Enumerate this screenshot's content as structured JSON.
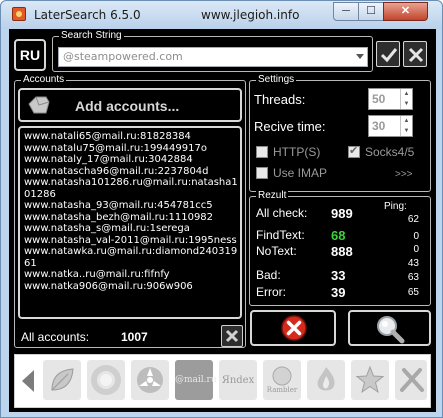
{
  "window": {
    "title": "LaterSearch 6.5.0",
    "site": "www.jlegioh.info",
    "min_label": "─",
    "max_label": "☐",
    "close_label": "✕"
  },
  "search": {
    "lang_label": "RU",
    "group_label": "Search String",
    "value": "@steampowered.com"
  },
  "accounts": {
    "group_label": "Accounts",
    "add_label": "Add accounts...",
    "lines": [
      "www.natali65@mail.ru:81828384",
      "www.natalu75@mail.ru:199449917o",
      "www.nataly_17@mail.ru:3042884",
      "www.natascha96@mail.ru:2237804d",
      "www.natasha101286.ru@mail.ru:natasha1",
      "01286",
      "www.natasha_93@mail.ru:454781cc5",
      "www.natasha_bezh@mail.ru:1110982",
      "www.natasha_s@mail.ru:1serega",
      "www.natasha_val-2011@mail.ru:1995ness",
      "www.natawka.ru@mail.ru:diamond240319",
      "61",
      "www.natka..ru@mail.ru:fifnfy",
      "www.natka906@mail.ru:906w906"
    ],
    "all_label": "All accounts:",
    "all_count": "1007"
  },
  "settings": {
    "group_label": "Settings",
    "threads_label": "Threads:",
    "threads_value": "50",
    "recive_label": "Recive time:",
    "recive_value": "30",
    "https_label": "HTTP(S)",
    "https_checked": false,
    "socks_label": "Socks4/5",
    "socks_checked": true,
    "imap_label": "Use IMAP",
    "imap_checked": false,
    "more_label": ">>>"
  },
  "rezult": {
    "group_label": "Rezult",
    "all_check_label": "All check:",
    "all_check_value": "989",
    "find_label": "FindText:",
    "find_value": "68",
    "notext_label": "NoText:",
    "notext_value": "888",
    "bad_label": "Bad:",
    "bad_value": "33",
    "error_label": "Error:",
    "error_value": "39",
    "ping_label": "Ping:",
    "pings": [
      "62",
      "0",
      "0",
      "43",
      "63",
      "65"
    ]
  },
  "toolbar": {
    "tiles": [
      {
        "name": "leaf",
        "text": ""
      },
      {
        "name": "ring",
        "text": ""
      },
      {
        "name": "radiation",
        "text": ""
      },
      {
        "name": "mailru",
        "text": "@mail.ru"
      },
      {
        "name": "yandex",
        "text": "Яndex"
      },
      {
        "name": "rambler",
        "text": "Rambler"
      },
      {
        "name": "flame",
        "text": ""
      },
      {
        "name": "star",
        "text": ""
      },
      {
        "name": "tools",
        "text": ""
      }
    ]
  },
  "colors": {
    "background": "#000000",
    "find_text": "#3cd33c",
    "stop_red": "#d42a1e"
  }
}
